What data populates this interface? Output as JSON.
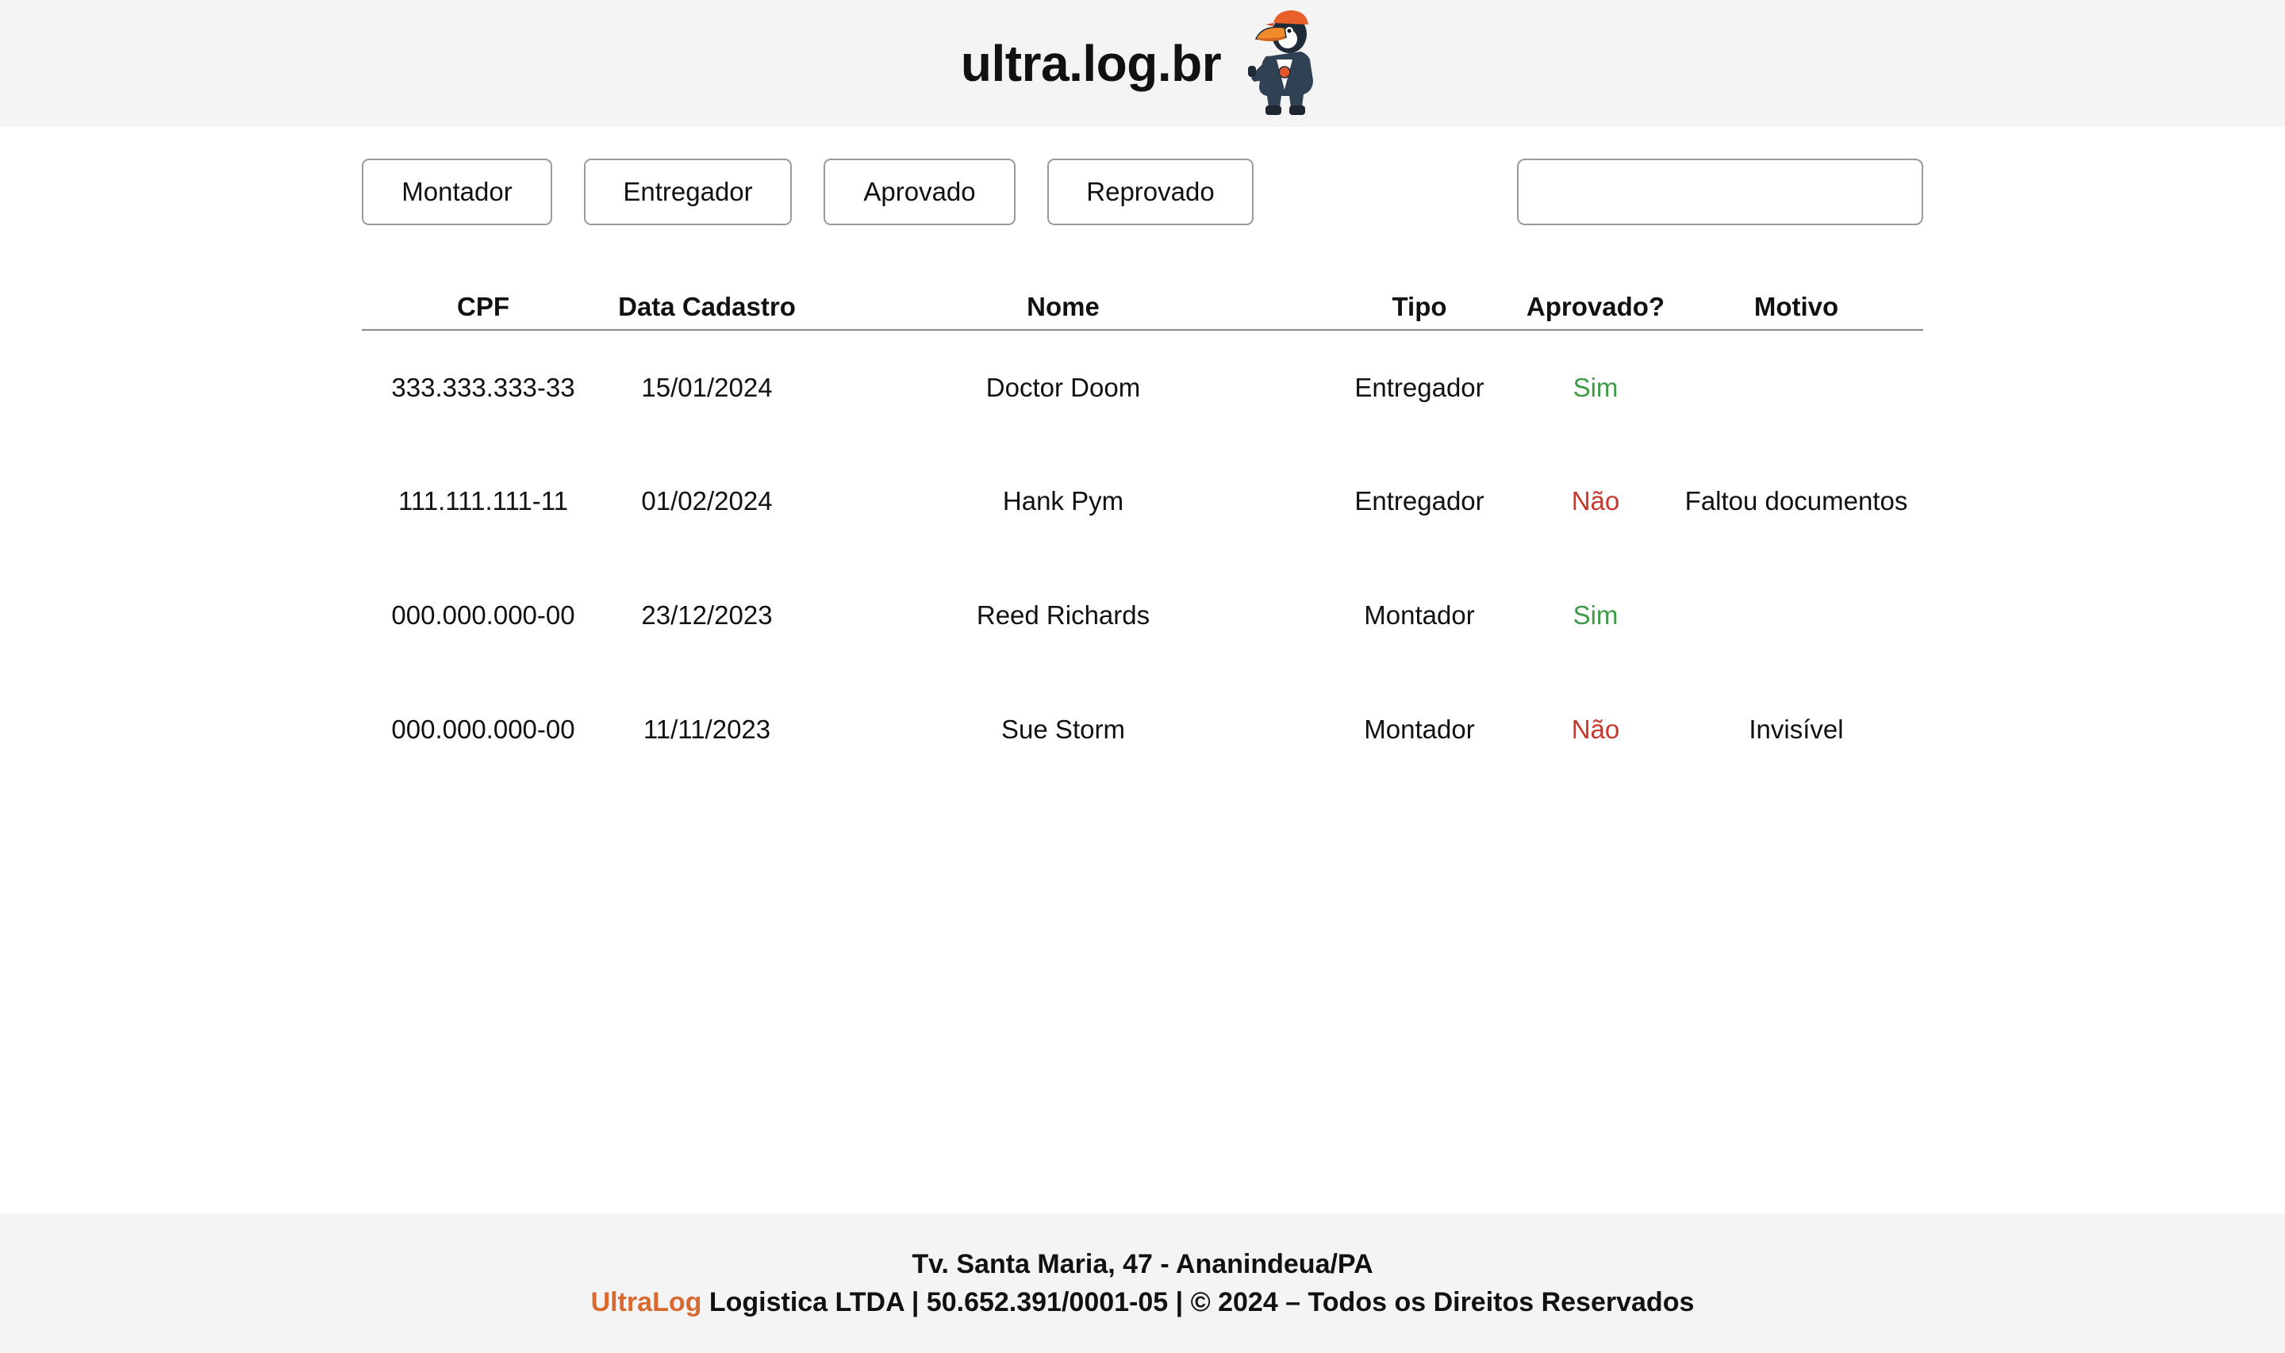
{
  "header": {
    "title": "ultra.log.br",
    "mascot_icon": "toucan-mascot-icon"
  },
  "filters": [
    {
      "label": "Montador"
    },
    {
      "label": "Entregador"
    },
    {
      "label": "Aprovado"
    },
    {
      "label": "Reprovado"
    }
  ],
  "search": {
    "value": "",
    "placeholder": ""
  },
  "table": {
    "columns": [
      "CPF",
      "Data Cadastro",
      "Nome",
      "Tipo",
      "Aprovado?",
      "Motivo"
    ],
    "rows": [
      {
        "cpf": "333.333.333-33",
        "data": "15/01/2024",
        "nome": "Doctor Doom",
        "tipo": "Entregador",
        "aprovado": "Sim",
        "motivo": ""
      },
      {
        "cpf": "111.111.111-11",
        "data": "01/02/2024",
        "nome": "Hank Pym",
        "tipo": "Entregador",
        "aprovado": "Não",
        "motivo": "Faltou documentos"
      },
      {
        "cpf": "000.000.000-00",
        "data": "23/12/2023",
        "nome": "Reed Richards",
        "tipo": "Montador",
        "aprovado": "Sim",
        "motivo": ""
      },
      {
        "cpf": "000.000.000-00",
        "data": "11/11/2023",
        "nome": "Sue Storm",
        "tipo": "Montador",
        "aprovado": "Não",
        "motivo": "Invisível"
      }
    ]
  },
  "footer": {
    "address": "Tv. Santa Maria, 47 - Ananindeua/PA",
    "brand": "UltraLog",
    "legal": "Logistica LTDA | 50.652.391/0001-05 | © 2024 – Todos os Direitos Reservados"
  },
  "colors": {
    "approved": "#3f9a47",
    "rejected": "#c9362c",
    "brand_accent": "#d9692e",
    "band_background": "#f4f4f5"
  }
}
